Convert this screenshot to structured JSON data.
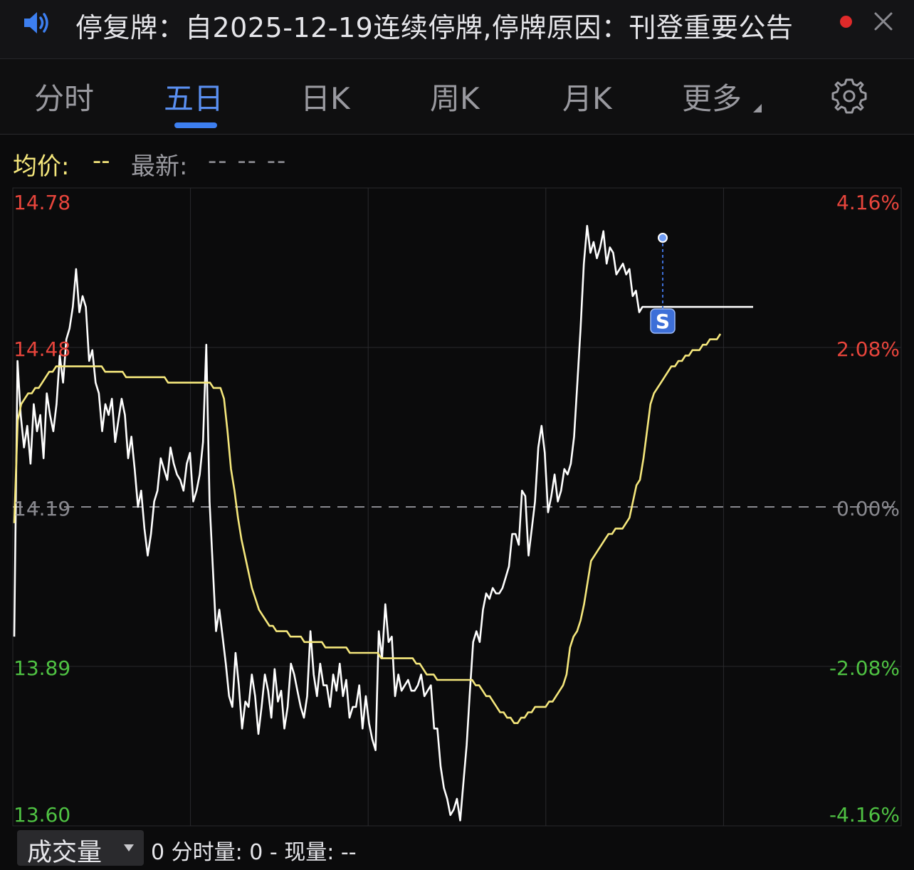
{
  "notice": {
    "text": "停复牌：自2025-12-19连续停牌,停牌原因：刊登重要公告",
    "speaker_icon": "speaker-icon",
    "dot_color": "#e02a2a",
    "close_icon": "close-icon"
  },
  "tabs": [
    {
      "label": "分时",
      "active": false
    },
    {
      "label": "五日",
      "active": true
    },
    {
      "label": "日K",
      "active": false
    },
    {
      "label": "周K",
      "active": false
    },
    {
      "label": "月K",
      "active": false
    },
    {
      "label": "更多",
      "active": false
    }
  ],
  "settings_icon": "gear-icon",
  "info": {
    "avg_label": "均价:",
    "avg_value": "--",
    "latest_label": "最新:",
    "latest_values": "-- -- --"
  },
  "volume": {
    "selector_label": "成交量",
    "text": "0 分时量: 0 - 现量: --"
  },
  "colors": {
    "up": "#e8453c",
    "down": "#4fc243",
    "avg_line": "#f5e77c",
    "price_line": "#ffffff",
    "active_tab": "#3d7ff0",
    "marker": "#3d6fd8"
  },
  "chart_data": {
    "type": "line",
    "days": 5,
    "prev_close": 14.19,
    "ylim": [
      13.6,
      14.78
    ],
    "y_ticks_left": [
      "14.78",
      "14.48",
      "14.19",
      "13.89",
      "13.60"
    ],
    "y_ticks_right": [
      "4.16%",
      "2.08%",
      "0.00%",
      "-2.08%",
      "-4.16%"
    ],
    "marker_label": "S",
    "series": [
      {
        "role": "price",
        "values": [
          13.95,
          14.46,
          14.36,
          14.3,
          14.34,
          14.27,
          14.38,
          14.33,
          14.36,
          14.28,
          14.4,
          14.36,
          14.33,
          14.38,
          14.47,
          14.42,
          14.5,
          14.52,
          14.56,
          14.63,
          14.55,
          14.58,
          14.56,
          14.46,
          14.48,
          14.42,
          14.4,
          14.33,
          14.38,
          14.36,
          14.39,
          14.31,
          14.35,
          14.39,
          14.36,
          14.28,
          14.32,
          14.26,
          14.19,
          14.22,
          14.15,
          14.1,
          14.14,
          14.2,
          14.22,
          14.28,
          14.26,
          14.24,
          14.3,
          14.27,
          14.25,
          14.24,
          14.22,
          14.27,
          14.29,
          14.2,
          14.22,
          14.25,
          14.31,
          14.49,
          14.2,
          14.08,
          13.96,
          14.0,
          13.95,
          13.9,
          13.84,
          13.82,
          13.92,
          13.86,
          13.78,
          13.83,
          13.82,
          13.88,
          13.84,
          13.77,
          13.82,
          13.88,
          13.85,
          13.8,
          13.89,
          13.83,
          13.85,
          13.78,
          13.82,
          13.9,
          13.88,
          13.85,
          13.82,
          13.8,
          13.84,
          13.96,
          13.88,
          13.84,
          13.9,
          13.86,
          13.86,
          13.82,
          13.88,
          13.85,
          13.9,
          13.84,
          13.87,
          13.8,
          13.82,
          13.82,
          13.86,
          13.78,
          13.84,
          13.79,
          13.76,
          13.74,
          13.96,
          13.91,
          14.01,
          13.94,
          13.95,
          13.84,
          13.88,
          13.85,
          13.86,
          13.87,
          13.85,
          13.85,
          13.86,
          13.88,
          13.84,
          13.85,
          13.86,
          13.78,
          13.78,
          13.71,
          13.67,
          13.65,
          13.62,
          13.63,
          13.65,
          13.61,
          13.68,
          13.75,
          13.85,
          13.94,
          13.96,
          13.94,
          14.0,
          14.03,
          14.02,
          14.04,
          14.03,
          14.03,
          14.04,
          14.06,
          14.08,
          14.14,
          14.14,
          14.12,
          14.22,
          14.21,
          14.1,
          14.15,
          14.2,
          14.3,
          14.34,
          14.29,
          14.18,
          14.21,
          14.25,
          14.2,
          14.22,
          14.26,
          14.25,
          14.27,
          14.32,
          14.42,
          14.52,
          14.64,
          14.71,
          14.66,
          14.68,
          14.65,
          14.67,
          14.7,
          14.64,
          14.67,
          14.66,
          14.62,
          14.63,
          14.64,
          14.62,
          14.63,
          14.58,
          14.59,
          14.55,
          14.56,
          14.56,
          14.56,
          14.56,
          14.56,
          14.56,
          14.56,
          14.56,
          14.56,
          14.56,
          14.56,
          14.56,
          14.56,
          14.56,
          14.56,
          14.56,
          14.56,
          14.56,
          14.56,
          14.56,
          14.56,
          14.56,
          14.56,
          14.56,
          14.56,
          14.56,
          14.56,
          14.56,
          14.56,
          14.56,
          14.56,
          14.56,
          14.56,
          14.56,
          14.56
        ]
      },
      {
        "role": "average",
        "values": [
          14.16,
          14.35,
          14.38,
          14.39,
          14.4,
          14.4,
          14.41,
          14.41,
          14.42,
          14.43,
          14.44,
          14.44,
          14.45,
          14.45,
          14.45,
          14.45,
          14.45,
          14.45,
          14.45,
          14.45,
          14.45,
          14.45,
          14.45,
          14.45,
          14.45,
          14.45,
          14.44,
          14.44,
          14.44,
          14.44,
          14.44,
          14.44,
          14.43,
          14.43,
          14.43,
          14.43,
          14.43,
          14.43,
          14.43,
          14.43,
          14.43,
          14.43,
          14.43,
          14.43,
          14.42,
          14.42,
          14.42,
          14.42,
          14.42,
          14.42,
          14.42,
          14.42,
          14.42,
          14.42,
          14.42,
          14.42,
          14.42,
          14.41,
          14.41,
          14.41,
          14.39,
          14.33,
          14.26,
          14.22,
          14.17,
          14.13,
          14.1,
          14.07,
          14.04,
          14.02,
          14.0,
          13.99,
          13.98,
          13.97,
          13.97,
          13.96,
          13.96,
          13.96,
          13.96,
          13.95,
          13.95,
          13.95,
          13.95,
          13.94,
          13.94,
          13.94,
          13.94,
          13.94,
          13.94,
          13.93,
          13.93,
          13.93,
          13.93,
          13.93,
          13.93,
          13.93,
          13.92,
          13.92,
          13.92,
          13.92,
          13.92,
          13.92,
          13.92,
          13.92,
          13.92,
          13.91,
          13.91,
          13.91,
          13.91,
          13.91,
          13.91,
          13.91,
          13.91,
          13.91,
          13.91,
          13.9,
          13.9,
          13.89,
          13.88,
          13.88,
          13.88,
          13.87,
          13.87,
          13.87,
          13.87,
          13.87,
          13.87,
          13.87,
          13.87,
          13.87,
          13.87,
          13.87,
          13.86,
          13.86,
          13.85,
          13.84,
          13.84,
          13.83,
          13.82,
          13.81,
          13.81,
          13.8,
          13.8,
          13.79,
          13.79,
          13.8,
          13.8,
          13.81,
          13.81,
          13.82,
          13.82,
          13.82,
          13.82,
          13.83,
          13.83,
          13.84,
          13.85,
          13.86,
          13.88,
          13.93,
          13.95,
          13.96,
          13.98,
          14.01,
          14.05,
          14.09,
          14.1,
          14.11,
          14.12,
          14.13,
          14.14,
          14.14,
          14.15,
          14.15,
          14.15,
          14.16,
          14.17,
          14.2,
          14.23,
          14.24,
          14.28,
          14.33,
          14.38,
          14.4,
          14.41,
          14.42,
          14.43,
          14.44,
          14.45,
          14.45,
          14.46,
          14.46,
          14.47,
          14.47,
          14.48,
          14.48,
          14.48,
          14.49,
          14.49,
          14.5,
          14.5,
          14.5,
          14.51
        ]
      }
    ]
  }
}
